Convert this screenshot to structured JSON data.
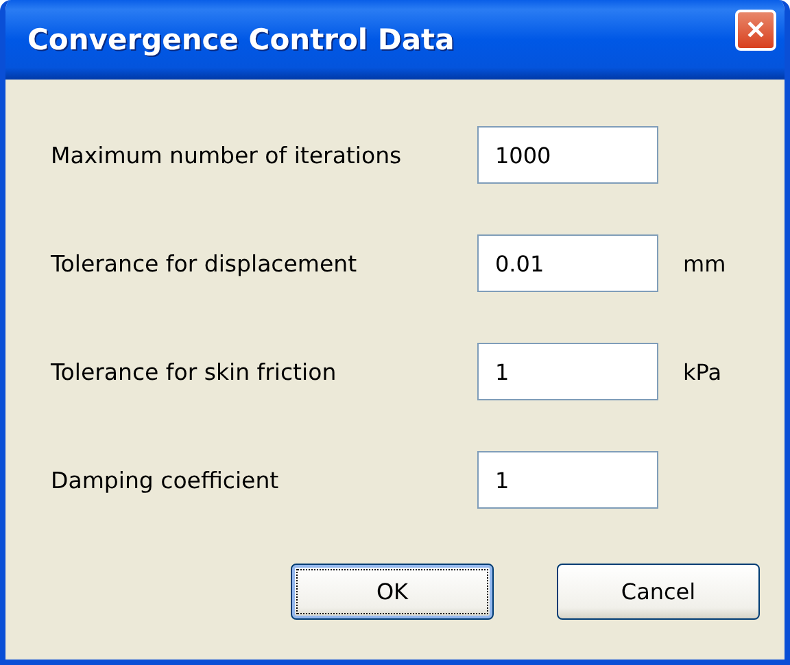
{
  "window": {
    "title": "Convergence Control Data",
    "close_glyph": "✕"
  },
  "fields": [
    {
      "label": "Maximum number of iterations",
      "value": "1000"
    },
    {
      "label": "Tolerance for displacement",
      "value": "0.01",
      "unit": "mm"
    },
    {
      "label": "Tolerance for skin friction",
      "value": "1",
      "unit": "kPa"
    },
    {
      "label": "Damping coefficient",
      "value": "1"
    }
  ],
  "buttons": [
    {
      "label": "OK",
      "focused": true
    },
    {
      "label": "Cancel",
      "focused": false
    }
  ]
}
